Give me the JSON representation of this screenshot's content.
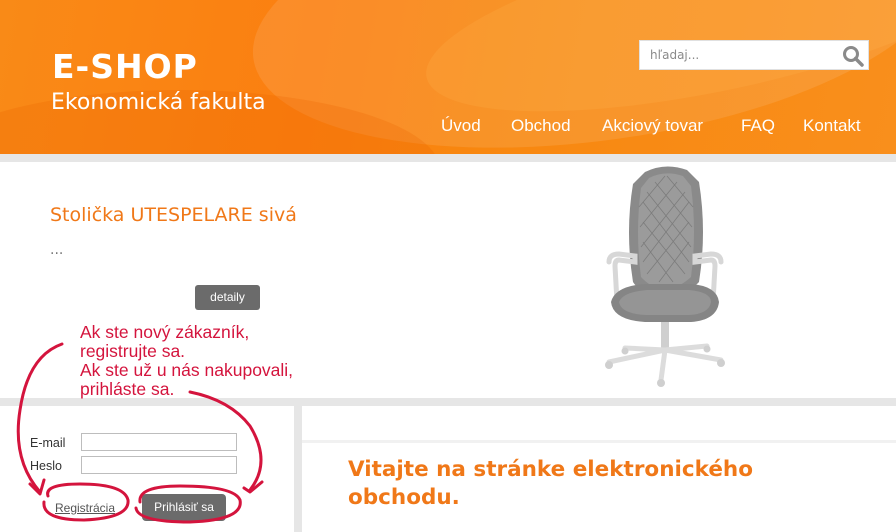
{
  "header": {
    "title": "E-SHOP",
    "subtitle": "Ekonomická fakulta",
    "brand_color": "#f98a17"
  },
  "search": {
    "placeholder": "hľadaj...",
    "icon": "search-icon"
  },
  "nav": {
    "items": [
      {
        "label": "Úvod"
      },
      {
        "label": "Obchod"
      },
      {
        "label": "Akciový tovar"
      },
      {
        "label": "FAQ"
      },
      {
        "label": "Kontakt"
      }
    ]
  },
  "slide": {
    "product_title": "Stolička UTESPELARE sivá",
    "product_desc": "...",
    "details_label": "detaily",
    "image": "office-gaming-chair-grey"
  },
  "annotation": {
    "lines": [
      "Ak ste nový zákazník,",
      "registrujte sa.",
      "Ak ste už u nás nakupovali,",
      "prihláste sa."
    ],
    "color": "#d4143d"
  },
  "login": {
    "email_label": "E-mail",
    "password_label": "Heslo",
    "email_value": "",
    "password_value": "",
    "register_label": "Registrácia",
    "login_label": "Prihlásiť sa"
  },
  "main": {
    "welcome": "Vitajte na stránke elektronického obchodu."
  }
}
